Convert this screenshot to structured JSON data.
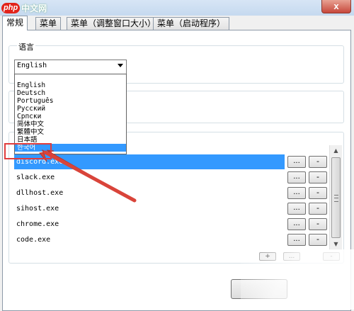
{
  "logo": {
    "php": "php",
    "cn": "中文网"
  },
  "title_bar": {
    "close": "x"
  },
  "tabs": [
    {
      "label": "常规",
      "active": true
    },
    {
      "label": "菜单",
      "active": false
    },
    {
      "label": "菜单（调整窗口大小）",
      "active": false
    },
    {
      "label": "菜单（启动程序）",
      "active": false
    }
  ],
  "language_group": {
    "label": "语言",
    "selected": "English"
  },
  "language_options": [
    "English",
    "Deutsch",
    "Português",
    "Русский",
    "Српски",
    "简体中文",
    "繁體中文",
    "日本語",
    "한국어"
  ],
  "selected_option_index": 8,
  "process_list": {
    "rows": [
      "discord.exe",
      "slack.exe",
      "dllhost.exe",
      "sihost.exe",
      "chrome.exe",
      "code.exe"
    ],
    "selected_index": 0,
    "browse_label": "...",
    "remove_label": "-"
  },
  "list_controls": {
    "add": "+",
    "edit": "...",
    "remove": "-"
  },
  "colors": {
    "selection": "#3399ff",
    "highlight_box": "#e03c3c",
    "close_button": "#c7473b"
  }
}
